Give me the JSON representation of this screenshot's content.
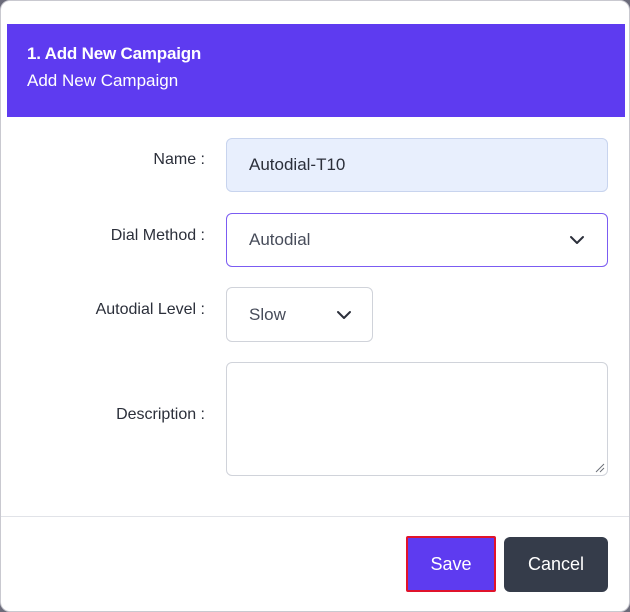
{
  "modal": {
    "title": "1. Add New Campaign",
    "subtitle": "Add New Campaign",
    "header_color": "#5e3bf0"
  },
  "form": {
    "name": {
      "label": "Name :",
      "value": "Autodial-T10"
    },
    "dial_method": {
      "label": "Dial Method :",
      "selected": "Autodial",
      "icon": "chevron-down-icon"
    },
    "autodial_level": {
      "label": "Autodial Level :",
      "selected": "Slow",
      "icon": "chevron-down-icon"
    },
    "description": {
      "label": "Description :",
      "value": ""
    }
  },
  "footer": {
    "save_label": "Save",
    "cancel_label": "Cancel",
    "save_color": "#5e3bf0",
    "cancel_color": "#353c4a",
    "highlight_color": "#e0132c"
  }
}
